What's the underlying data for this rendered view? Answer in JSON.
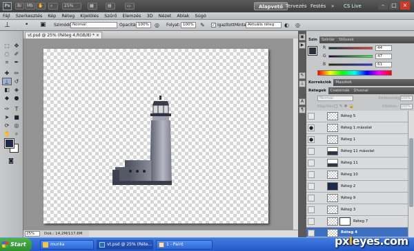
{
  "appbar": {
    "logo": "Ps",
    "zoom": "25%",
    "workspaces": [
      "Alapvető",
      "Tervezés",
      "Festés"
    ],
    "more": "»",
    "cslive": "CS Live"
  },
  "menu": [
    "Fájl",
    "Szerkesztés",
    "Kép",
    "Réteg",
    "Kijelölés",
    "Szűrő",
    "Elemzés",
    "3D",
    "Nézet",
    "Ablak",
    "Súgó"
  ],
  "options": {
    "mode_label": "Szimódó:",
    "mode_value": "Normál",
    "opacity_label": "Opacitás:",
    "opacity_value": "100%",
    "flow_label": "Folyat:",
    "flow_value": "100%",
    "aligned_label": "Igazított",
    "sample_label": "Minta:",
    "sample_value": "Aktuális réteg"
  },
  "document": {
    "tab": "vt.psd @ 25% (Réteg 4,RGB/8) *",
    "zoom": "25%",
    "doc_info": "Dok.: 14,2M/117,6M"
  },
  "color_panel": {
    "tabs": [
      "Szín",
      "Színtár",
      "Stílusok"
    ],
    "r_label": "R",
    "g_label": "G",
    "b_label": "B",
    "r": "44",
    "g": "47",
    "b": "61",
    "fg_color": "#2c2f3d"
  },
  "adjust_panel": {
    "tabs": [
      "Korrekciók",
      "Maszkok"
    ]
  },
  "layers_panel": {
    "tabs": [
      "Rétegek",
      "Csatornák",
      "Útvonal"
    ],
    "blend": "Normál",
    "opacity_label": "Átlátszóság:",
    "opacity": "100%",
    "lock_label": "Rögzítés:",
    "fill_label": "Kitöltés:",
    "fill": "100%",
    "layers": [
      {
        "name": "Réteg 5",
        "eye": ""
      },
      {
        "name": "Réteg 1 másolat",
        "eye": "●"
      },
      {
        "name": "Réteg 1",
        "eye": "●"
      },
      {
        "name": "Réteg 11 másolat",
        "eye": ""
      },
      {
        "name": "Réteg 11",
        "eye": ""
      },
      {
        "name": "Réteg 10",
        "eye": ""
      },
      {
        "name": "Réteg 2",
        "eye": ""
      },
      {
        "name": "Réteg 9",
        "eye": ""
      },
      {
        "name": "Réteg 3",
        "eye": ""
      },
      {
        "name": "Réteg 7",
        "eye": ""
      },
      {
        "name": "Réteg 4",
        "eye": ""
      }
    ]
  },
  "taskbar": {
    "start": "Start",
    "tasks": [
      "munka",
      "vt.psd @ 25% (Réte...",
      "1 - Paint"
    ]
  },
  "watermark": {
    "a": "px",
    "b": "l",
    "c": "eyes.com"
  }
}
